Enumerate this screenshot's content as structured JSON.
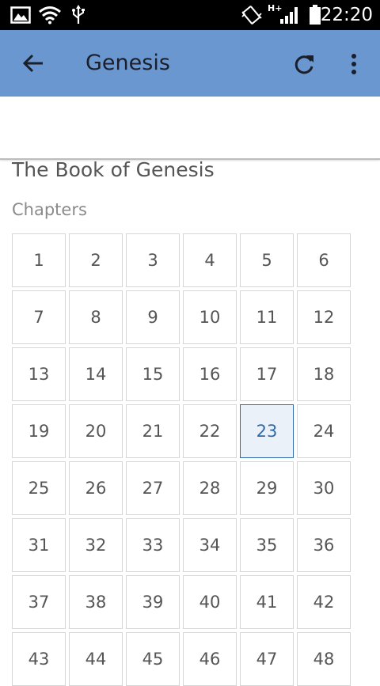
{
  "status_bar": {
    "time": "22:20",
    "network_label": "H+"
  },
  "toolbar": {
    "title": "Genesis"
  },
  "content": {
    "book_title": "The Book of Genesis",
    "section_label": "Chapters",
    "chapters": [
      "1",
      "2",
      "3",
      "4",
      "5",
      "6",
      "7",
      "8",
      "9",
      "10",
      "11",
      "12",
      "13",
      "14",
      "15",
      "16",
      "17",
      "18",
      "19",
      "20",
      "21",
      "22",
      "23",
      "24",
      "25",
      "26",
      "27",
      "28",
      "29",
      "30",
      "31",
      "32",
      "33",
      "34",
      "35",
      "36",
      "37",
      "38",
      "39",
      "40",
      "41",
      "42",
      "43",
      "44",
      "45",
      "46",
      "47",
      "48"
    ],
    "selected_chapter": "23"
  },
  "colors": {
    "toolbar_bg": "#6a97cf",
    "selected_border": "#2f6aa8",
    "selected_bg": "#eaf1f9"
  }
}
